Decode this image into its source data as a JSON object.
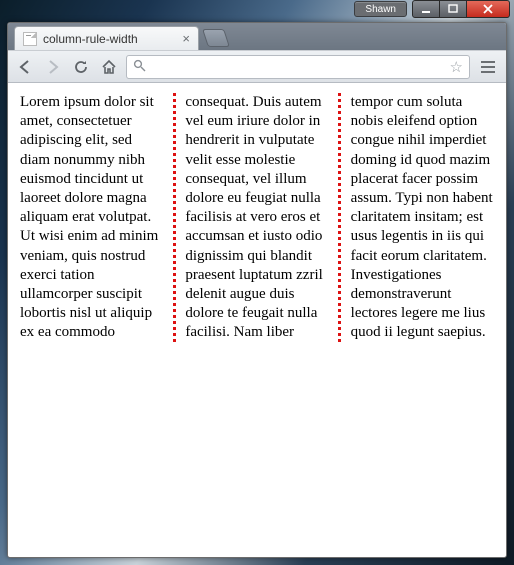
{
  "window": {
    "user_label": "Shawn"
  },
  "browser": {
    "tab_title": "column-rule-width",
    "url_value": ""
  },
  "content": {
    "paragraph": "Lorem ipsum dolor sit amet, consectetuer adipiscing elit, sed diam nonummy nibh euismod tincidunt ut laoreet dolore magna aliquam erat volutpat. Ut wisi enim ad minim veniam, quis nostrud exerci tation ullamcorper suscipit lobortis nisl ut aliquip ex ea commodo consequat. Duis autem vel eum iriure dolor in hendrerit in vulputate velit esse molestie consequat, vel illum dolore eu feugiat nulla facilisis at vero eros et accumsan et iusto odio dignissim qui blandit praesent luptatum zzril delenit augue duis dolore te feugait nulla facilisi. Nam liber tempor cum soluta nobis eleifend option congue nihil imperdiet doming id quod mazim placerat facer possim assum. Typi non habent claritatem insitam; est usus legentis in iis qui facit eorum claritatem. Investigationes demonstraverunt lectores legere me lius quod ii legunt saepius."
  }
}
